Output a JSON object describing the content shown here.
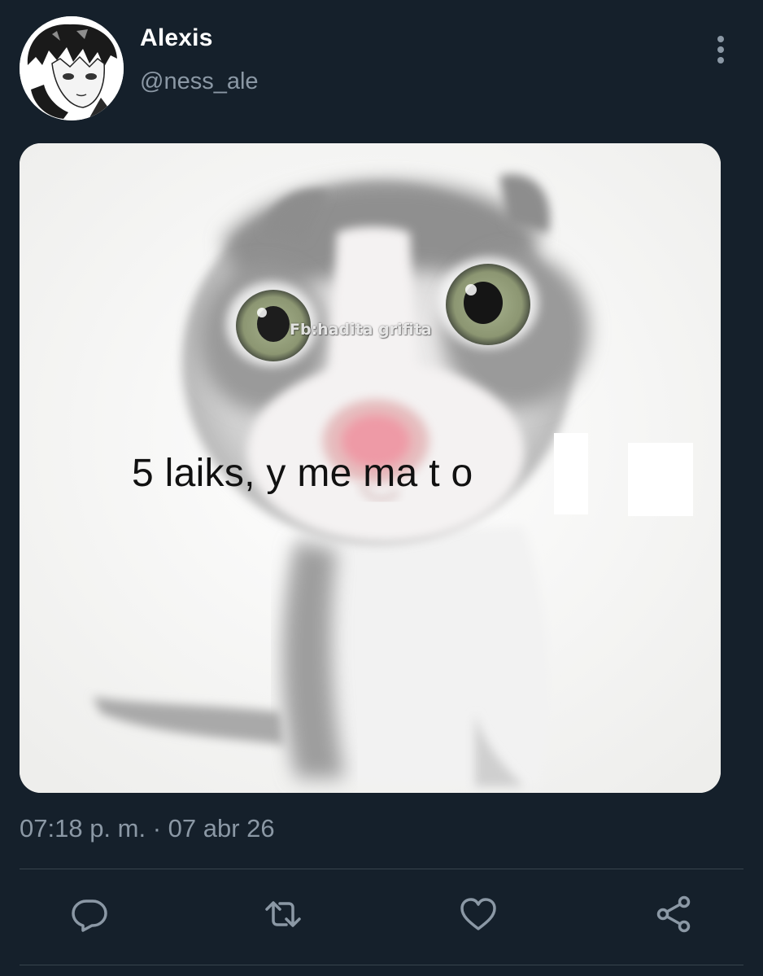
{
  "tweet": {
    "display_name": "Alexis",
    "handle": "@ness_ale",
    "timestamp": "07:18 p. m. · 07 abr 26",
    "media": {
      "watermark": "Fb:hadita grifita",
      "caption": "5 laiks, y me ma t o"
    }
  },
  "actions": [
    {
      "name": "reply",
      "icon": "reply-icon"
    },
    {
      "name": "retweet",
      "icon": "retweet-icon"
    },
    {
      "name": "like",
      "icon": "heart-icon"
    },
    {
      "name": "share",
      "icon": "share-icon"
    }
  ],
  "colors": {
    "background": "#15202b",
    "secondary_text": "#8b98a5",
    "divider": "#38444d",
    "primary_text": "#ffffff"
  }
}
